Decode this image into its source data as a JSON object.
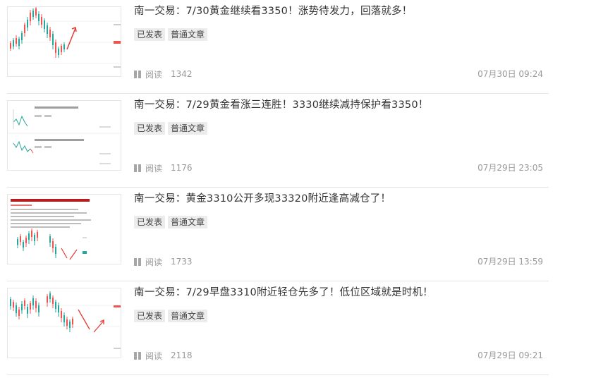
{
  "articles": [
    {
      "title": "南一交易：7/30黄金继续看3350！涨势待发力，回落就多！",
      "tags": [
        "已发表",
        "普通文章"
      ],
      "read_label": "阅读",
      "reads": "1342",
      "date": "07月30日 09:24",
      "thumb": "candlestick-chart-with-red-arrow"
    },
    {
      "title": "南一交易：7/29黄金看涨三连胜！3330继续减持保护看3350！",
      "tags": [
        "已发表",
        "普通文章"
      ],
      "read_label": "阅读",
      "reads": "1176",
      "date": "07月29日 23:05",
      "thumb": "article-list-screenshot"
    },
    {
      "title": "南一交易：黄金3310公开多现33320附近逢高减仓了！",
      "tags": [
        "已发表",
        "普通文章"
      ],
      "read_label": "阅读",
      "reads": "1733",
      "date": "07月29日 13:59",
      "thumb": "article-with-chart-screenshot"
    },
    {
      "title": "南一交易：7/29早盘3310附近轻仓先多了！低位区域就是时机！",
      "tags": [
        "已发表",
        "普通文章"
      ],
      "read_label": "阅读",
      "reads": "2118",
      "date": "07月29日 09:21",
      "thumb": "candlestick-chart-with-red-arrows"
    }
  ],
  "colors": {
    "up_candle": "#26a69a",
    "down_candle": "#ef5350",
    "arrow": "#e53935",
    "divider": "#e4e4e4",
    "meta_text": "#999999",
    "tag_bg": "#ececec"
  }
}
